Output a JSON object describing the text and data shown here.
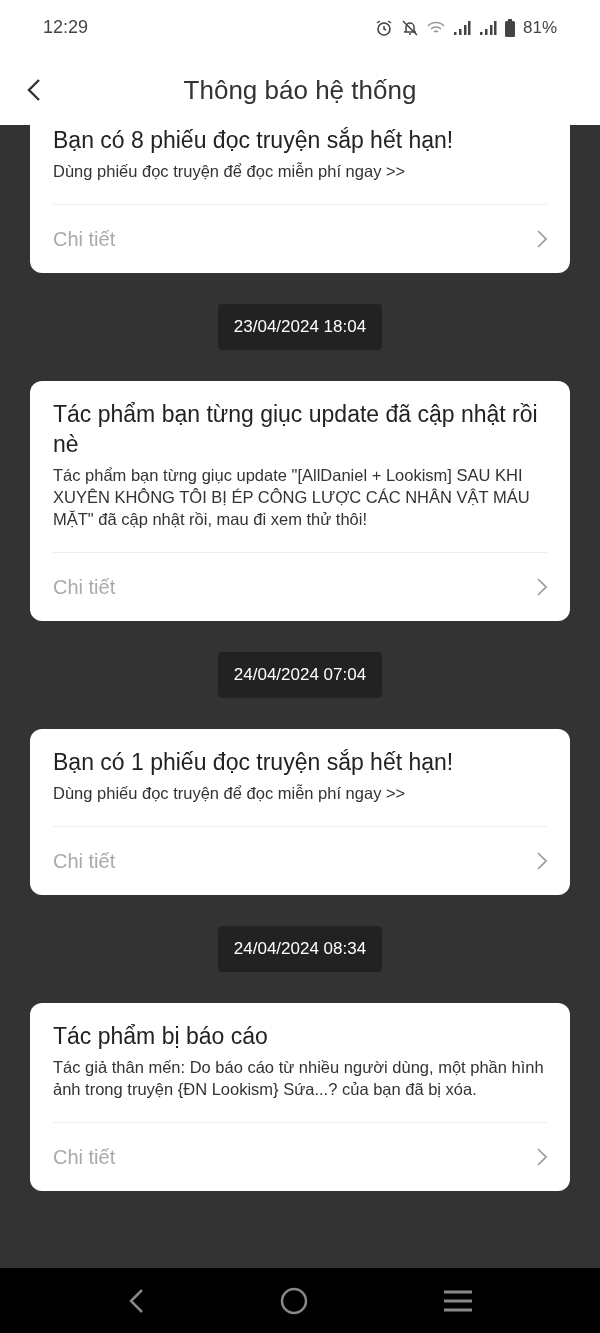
{
  "status_bar": {
    "time": "12:29",
    "battery": "81%"
  },
  "header": {
    "title": "Thông báo hệ thống"
  },
  "items": [
    {
      "kind": "card",
      "cut_top": true,
      "title": "Bạn có 8 phiếu đọc truyện sắp hết hạn!",
      "body": "Dùng phiếu đọc truyện để đọc miễn phí ngay >>",
      "link": "Chi tiết"
    },
    {
      "kind": "date",
      "text": "23/04/2024 18:04"
    },
    {
      "kind": "card",
      "cut_top": false,
      "title": "Tác phẩm bạn từng giục update đã cập nhật rồi nè",
      "body": "Tác phẩm bạn từng giục update \"[AllDaniel + Lookism] SAU KHI XUYÊN KHÔNG TÔI BỊ ÉP CÔNG LƯỢC CÁC NHÂN VẬT MÁU MẶT\" đã cập nhật rồi, mau đi xem thử thôi!",
      "link": "Chi tiết"
    },
    {
      "kind": "date",
      "text": "24/04/2024 07:04"
    },
    {
      "kind": "card",
      "cut_top": false,
      "title": "Bạn có 1 phiếu đọc truyện sắp hết hạn!",
      "body": "Dùng phiếu đọc truyện để đọc miễn phí ngay >>",
      "link": "Chi tiết"
    },
    {
      "kind": "date",
      "text": "24/04/2024 08:34"
    },
    {
      "kind": "card",
      "cut_top": false,
      "title": "Tác phẩm bị báo cáo",
      "body": "Tác giả thân mến: Do báo cáo từ nhiều người dùng, một phần hình ảnh trong truyện {ĐN Lookism} Sứa...? của bạn đã bị xóa.",
      "link": "Chi tiết"
    }
  ]
}
